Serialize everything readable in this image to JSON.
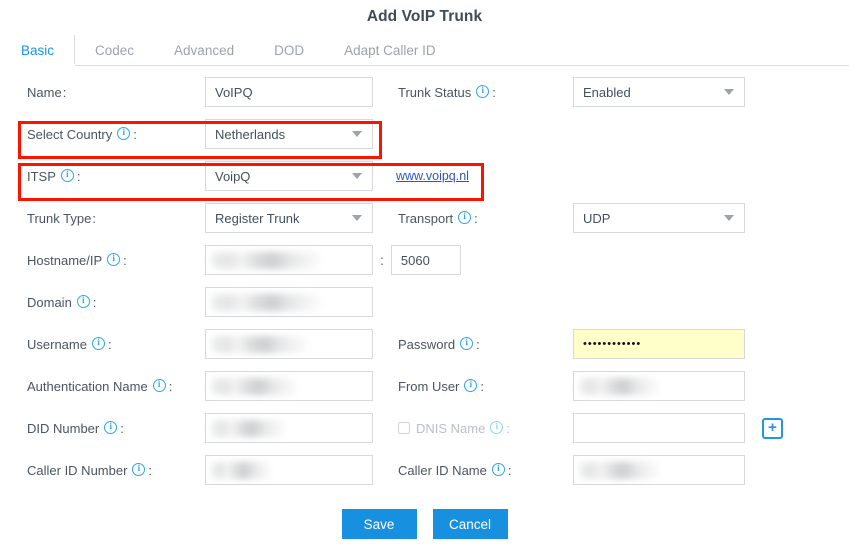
{
  "dialog": {
    "title": "Add VoIP Trunk"
  },
  "tabs": [
    {
      "label": "Basic",
      "active": true
    },
    {
      "label": "Codec",
      "active": false
    },
    {
      "label": "Advanced",
      "active": false
    },
    {
      "label": "DOD",
      "active": false
    },
    {
      "label": "Adapt Caller ID",
      "active": false
    }
  ],
  "form": {
    "name": {
      "label": "Name",
      "colon": ":",
      "value": "VoIPQ"
    },
    "trunk_status": {
      "label": "Trunk Status",
      "colon": ":",
      "value": "Enabled"
    },
    "select_country": {
      "label": "Select Country",
      "colon": ":",
      "value": "Netherlands"
    },
    "itsp": {
      "label": "ITSP",
      "colon": ":",
      "value": "VoipQ",
      "link": "www.voipq.nl"
    },
    "trunk_type": {
      "label": "Trunk Type",
      "colon": ":",
      "value": "Register Trunk"
    },
    "transport": {
      "label": "Transport",
      "colon": ":",
      "value": "UDP"
    },
    "hostname_ip": {
      "label": "Hostname/IP",
      "colon": ":",
      "value": "",
      "separator": ":"
    },
    "port": {
      "value": "5060"
    },
    "domain": {
      "label": "Domain",
      "colon": ":",
      "value": ""
    },
    "username": {
      "label": "Username",
      "colon": ":",
      "value": ""
    },
    "password": {
      "label": "Password",
      "colon": ":",
      "value": "••••••••••••"
    },
    "authentication_name": {
      "label": "Authentication Name",
      "colon": ":",
      "value": ""
    },
    "from_user": {
      "label": "From User",
      "colon": ":",
      "value": ""
    },
    "did_number": {
      "label": "DID Number",
      "colon": ":",
      "value": ""
    },
    "dnis_name": {
      "label": "DNIS Name",
      "colon": ":",
      "value": "",
      "checked": false
    },
    "caller_id_number": {
      "label": "Caller ID Number",
      "colon": ":",
      "value": ""
    },
    "caller_id_name": {
      "label": "Caller ID Name",
      "colon": ":",
      "value": ""
    },
    "add_dnis_button": {
      "label": "+"
    }
  },
  "footer": {
    "save_label": "Save",
    "cancel_label": "Cancel"
  },
  "icons": {
    "info": "i",
    "dropdown": "chevron-down-icon"
  },
  "colors": {
    "accent": "#1890e0",
    "tab_active": "#1596e6",
    "highlight": "#fb1400",
    "link": "#2a58c8",
    "password_bg": "#feffc9",
    "info_icon": "#2aa8e8"
  }
}
